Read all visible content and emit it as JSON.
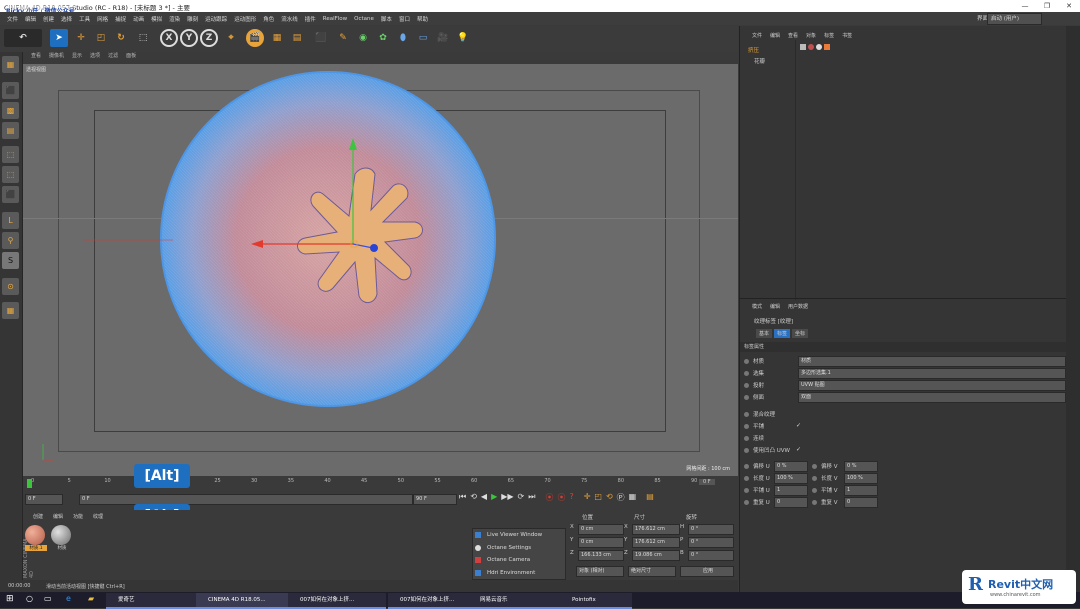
{
  "window": {
    "title": "CINEMA 4D R18.057 Studio (RC - R18) - [未标题 3 *] - 主要",
    "overlay_watermark": "Ricky 小仟 / 微信公众号"
  },
  "menubar": {
    "items": [
      "文件",
      "编辑",
      "创建",
      "选择",
      "工具",
      "网格",
      "捕捉",
      "动画",
      "模拟",
      "渲染",
      "雕刻",
      "运动跟踪",
      "运动图形",
      "角色",
      "流水线",
      "插件",
      "RealFlow",
      "Octane",
      "脚本",
      "窗口",
      "帮助"
    ],
    "layout_label": "界面",
    "layout_value": "启动 (用户)"
  },
  "toolbar": {
    "axis_x": "X",
    "axis_y": "Y",
    "axis_z": "Z"
  },
  "viewport": {
    "menu": [
      "查看",
      "摄像机",
      "显示",
      "选项",
      "过滤",
      "面板"
    ],
    "camera_label": "透视视图",
    "grid_spacing": "网格间距 : 100 cm"
  },
  "timeline": {
    "ticks": [
      "0",
      "5",
      "10",
      "15",
      "20",
      "25",
      "30",
      "35",
      "40",
      "45",
      "50",
      "55",
      "60",
      "65",
      "70",
      "75",
      "80",
      "85",
      "90"
    ],
    "end_frame_label": "0 F",
    "current_frame": "0 F",
    "start_field": "0 F",
    "end_field": "90 F",
    "end_field2": "90 F"
  },
  "overlays": {
    "alt_key_1": "[Alt]",
    "alt_key_2": "[Alt]"
  },
  "materials": {
    "menu": [
      "创建",
      "编辑",
      "功能",
      "纹理"
    ],
    "items": [
      {
        "name": "材质.1"
      },
      {
        "name": "材质"
      }
    ],
    "maxon_label": "MAXON CINEMA 4D"
  },
  "octane_menu": {
    "items": [
      "Live Viewer Window",
      "Octane Settings",
      "Octane Camera",
      "Hdri Environment"
    ]
  },
  "coordinates": {
    "headers": [
      "位置",
      "尺寸",
      "旋转"
    ],
    "rows": [
      {
        "axis": "X",
        "pos": "0 cm",
        "size_axis": "X",
        "size": "176.612 cm",
        "rot_axis": "H",
        "rot": "0 °"
      },
      {
        "axis": "Y",
        "pos": "0 cm",
        "size_axis": "Y",
        "size": "176.612 cm",
        "rot_axis": "P",
        "rot": "0 °"
      },
      {
        "axis": "Z",
        "pos": "166.133 cm",
        "size_axis": "Z",
        "size": "19.086 cm",
        "rot_axis": "B",
        "rot": "0 °"
      }
    ],
    "mode_dropdown": "对象 (相对)",
    "size_dropdown": "绝对尺寸",
    "apply_button": "应用"
  },
  "object_manager": {
    "menu": [
      "文件",
      "编辑",
      "查看",
      "对象",
      "标签",
      "书签"
    ],
    "objects": [
      {
        "name": "挤压"
      },
      {
        "name": "花瓣"
      }
    ]
  },
  "attributes": {
    "menu": [
      "模式",
      "编辑",
      "用户数据"
    ],
    "title": "纹理标签 [纹理]",
    "tabs": [
      "基本",
      "标签",
      "坐标"
    ],
    "section": "标签属性",
    "props": [
      {
        "label": "材质",
        "value": "材质"
      },
      {
        "label": "选集",
        "value": "多边形选集.1"
      },
      {
        "label": "投射",
        "value": "UVW 贴图"
      },
      {
        "label": "侧面",
        "value": "双面"
      }
    ],
    "checks": [
      {
        "label": "混合纹理",
        "value": ""
      },
      {
        "label": "平铺",
        "value": "✓"
      },
      {
        "label": "连续",
        "value": ""
      },
      {
        "label": "使用凹凸 UVW",
        "value": "✓"
      }
    ],
    "offsets": [
      {
        "l1": "偏移 U",
        "v1": "0 %",
        "l2": "偏移 V",
        "v2": "0 %"
      },
      {
        "l1": "长度 U",
        "v1": "100 %",
        "l2": "长度 V",
        "v2": "100 %"
      },
      {
        "l1": "平铺 U",
        "v1": "1",
        "l2": "平铺 V",
        "v2": "1"
      },
      {
        "l1": "重复 U",
        "v1": "0",
        "l2": "重复 V",
        "v2": "0"
      }
    ]
  },
  "status": {
    "time": "00:00:00",
    "hint": "滑动当前活动视图 [快捷键 Ctrl+R]"
  },
  "taskbar": {
    "items": [
      "爱奇艺",
      "CINEMA 4D R18.05...",
      "007如何在对象上挤...",
      "007如何在对象上挤...",
      "网易云音乐",
      "Pointofix"
    ]
  },
  "brand": {
    "name": "Revit中文网",
    "url": "www.chinarevit.com"
  },
  "colors": {
    "accent_orange": "#e8a33a",
    "octane_blue": "#1e6fc0",
    "sphere_blue": "#5a9fe6",
    "sphere_pink": "#c9868e",
    "shape_fill": "#e8b079"
  }
}
